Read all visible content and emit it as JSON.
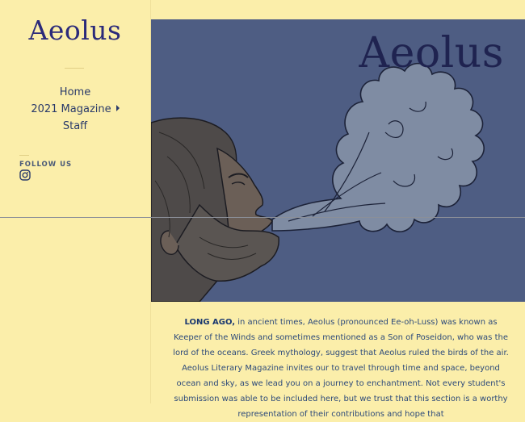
{
  "site": {
    "logo_text": "Aeolus"
  },
  "nav": {
    "items": [
      {
        "label": "Home"
      },
      {
        "label": "2021 Magazine"
      },
      {
        "label": "Staff"
      }
    ]
  },
  "social": {
    "heading": "FOLLOW US",
    "icon": "instagram-icon"
  },
  "hero": {
    "title": "Aeolus",
    "illustration": "bearded-man-blowing-wind-illustration"
  },
  "intro": {
    "lead": "LONG AGO,",
    "body": " in ancient times, Aeolus (pronounced Ee-oh-Luss) was known as Keeper of the Winds and sometimes mentioned as a Son of Poseidon, who was the lord of the oceans. Greek mythology, suggest that Aeolus ruled the birds of the air. Aeolus Literary Magazine invites our to travel through time and space, beyond ocean and sky, as we lead you on a journey to enchantment. Not every student's submission was able to be included here, but we trust that this section is a worthy representation of their contributions and hope that"
  },
  "colors": {
    "page_bg": "#fbeeaa",
    "hero_bg": "#4e5d83",
    "logo": "#2b2a7a",
    "text": "#2d4a7a"
  }
}
